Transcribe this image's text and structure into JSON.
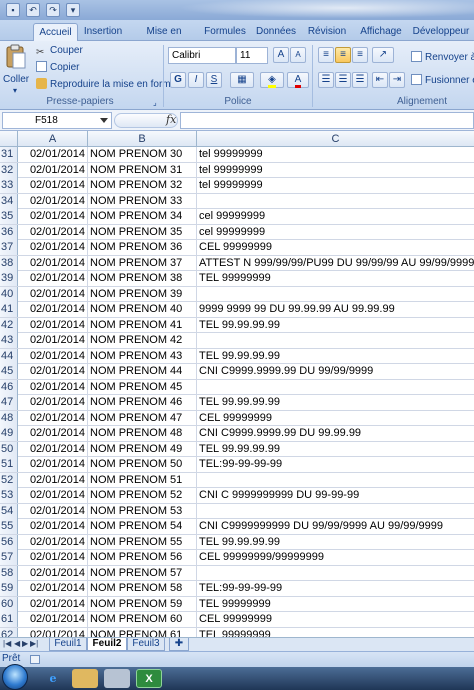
{
  "ribbon": {
    "tabs": [
      "Accueil",
      "Insertion",
      "Mise en page",
      "Formules",
      "Données",
      "Révision",
      "Affichage",
      "Développeur"
    ],
    "clipboard": {
      "paste_label": "Coller",
      "cut_label": "Couper",
      "copy_label": "Copier",
      "format_painter_label": "Reproduire la mise en forme",
      "group_label": "Presse-papiers"
    },
    "font": {
      "family": "Calibri",
      "size": "11",
      "bold": "G",
      "italic": "I",
      "underline": "S",
      "grow": "A",
      "shrink": "A",
      "group_label": "Police"
    },
    "alignment": {
      "wrap_label": "Renvoyer à",
      "merge_label": "Fusionner et",
      "group_label": "Alignement"
    }
  },
  "formula_bar": {
    "name_box": "F518",
    "fx": "fx",
    "content": ""
  },
  "columns": [
    "A",
    "B",
    "C"
  ],
  "rows": [
    {
      "n": "31",
      "a": "02/01/2014",
      "b": "NOM PRENOM 30",
      "c": "tel 99999999"
    },
    {
      "n": "32",
      "a": "02/01/2014",
      "b": "NOM PRENOM 31",
      "c": "tel 99999999"
    },
    {
      "n": "33",
      "a": "02/01/2014",
      "b": "NOM PRENOM 32",
      "c": "tel 99999999"
    },
    {
      "n": "34",
      "a": "02/01/2014",
      "b": "NOM PRENOM 33",
      "c": ""
    },
    {
      "n": "35",
      "a": "02/01/2014",
      "b": "NOM PRENOM 34",
      "c": "cel 99999999"
    },
    {
      "n": "36",
      "a": "02/01/2014",
      "b": "NOM PRENOM 35",
      "c": "cel 99999999"
    },
    {
      "n": "37",
      "a": "02/01/2014",
      "b": "NOM PRENOM 36",
      "c": "CEL 99999999"
    },
    {
      "n": "38",
      "a": "02/01/2014",
      "b": "NOM PRENOM 37",
      "c": "ATTEST N 999/99/99/PU99 DU 99/99/99 AU 99/99/9999"
    },
    {
      "n": "39",
      "a": "02/01/2014",
      "b": "NOM PRENOM 38",
      "c": "TEL 99999999"
    },
    {
      "n": "40",
      "a": "02/01/2014",
      "b": "NOM PRENOM 39",
      "c": ""
    },
    {
      "n": "41",
      "a": "02/01/2014",
      "b": "NOM PRENOM 40",
      "c": "9999 9999 99 DU 99.99.99 AU 99.99.99"
    },
    {
      "n": "42",
      "a": "02/01/2014",
      "b": "NOM PRENOM 41",
      "c": "TEL 99.99.99.99"
    },
    {
      "n": "43",
      "a": "02/01/2014",
      "b": "NOM PRENOM 42",
      "c": ""
    },
    {
      "n": "44",
      "a": "02/01/2014",
      "b": "NOM PRENOM 43",
      "c": "TEL 99.99.99.99"
    },
    {
      "n": "45",
      "a": "02/01/2014",
      "b": "NOM PRENOM 44",
      "c": "CNI C9999.9999.99 DU 99/99/9999"
    },
    {
      "n": "46",
      "a": "02/01/2014",
      "b": "NOM PRENOM 45",
      "c": ""
    },
    {
      "n": "47",
      "a": "02/01/2014",
      "b": "NOM PRENOM 46",
      "c": "TEL 99.99.99.99"
    },
    {
      "n": "48",
      "a": "02/01/2014",
      "b": "NOM PRENOM 47",
      "c": "CEL 99999999"
    },
    {
      "n": "49",
      "a": "02/01/2014",
      "b": "NOM PRENOM 48",
      "c": "CNI C9999.9999.99 DU 99.99.99"
    },
    {
      "n": "50",
      "a": "02/01/2014",
      "b": "NOM PRENOM 49",
      "c": "TEL 99.99.99.99"
    },
    {
      "n": "51",
      "a": "02/01/2014",
      "b": "NOM PRENOM 50",
      "c": "TEL:99-99-99-99"
    },
    {
      "n": "52",
      "a": "02/01/2014",
      "b": "NOM PRENOM 51",
      "c": ""
    },
    {
      "n": "53",
      "a": "02/01/2014",
      "b": "NOM PRENOM 52",
      "c": "CNI C 9999999999 DU 99-99-99"
    },
    {
      "n": "54",
      "a": "02/01/2014",
      "b": "NOM PRENOM 53",
      "c": ""
    },
    {
      "n": "55",
      "a": "02/01/2014",
      "b": "NOM PRENOM 54",
      "c": "CNI C9999999999 DU 99/99/9999 AU 99/99/9999"
    },
    {
      "n": "56",
      "a": "02/01/2014",
      "b": "NOM PRENOM 55",
      "c": "TEL 99.99.99.99"
    },
    {
      "n": "57",
      "a": "02/01/2014",
      "b": "NOM PRENOM 56",
      "c": "CEL 99999999/99999999"
    },
    {
      "n": "58",
      "a": "02/01/2014",
      "b": "NOM PRENOM 57",
      "c": ""
    },
    {
      "n": "59",
      "a": "02/01/2014",
      "b": "NOM PRENOM 58",
      "c": "TEL:99-99-99-99"
    },
    {
      "n": "60",
      "a": "02/01/2014",
      "b": "NOM PRENOM 59",
      "c": "TEL 99999999"
    },
    {
      "n": "61",
      "a": "02/01/2014",
      "b": "NOM PRENOM 60",
      "c": "CEL 99999999"
    },
    {
      "n": "62",
      "a": "02/01/2014",
      "b": "NOM PRENOM 61",
      "c": "TEL 99999999"
    }
  ],
  "sheets": {
    "tabs": [
      "Feuil1",
      "Feuil2",
      "Feuil3"
    ],
    "active": "Feuil2"
  },
  "status": {
    "text": "Prêt"
  },
  "colors": {
    "ribbon_text": "#15428b",
    "grid_line": "#d0d7e5",
    "header_border": "#9eb6ce"
  }
}
